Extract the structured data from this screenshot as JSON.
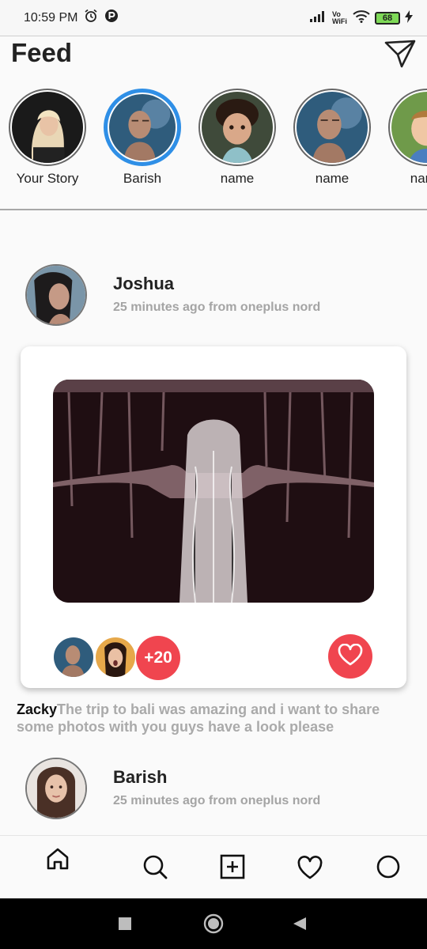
{
  "status_bar": {
    "time": "10:59 PM",
    "network_label": "Vo WiFi",
    "battery": "68"
  },
  "header": {
    "title": "Feed",
    "icons": {
      "send": "paper-plane-icon"
    }
  },
  "stories": [
    {
      "label": "Your Story",
      "active": false
    },
    {
      "label": "Barish",
      "active": true
    },
    {
      "label": "name",
      "active": false
    },
    {
      "label": "name",
      "active": false
    },
    {
      "label": "name",
      "active": false
    }
  ],
  "posts": [
    {
      "author": "Joshua",
      "meta": "25 minutes ago from oneplus nord",
      "likers_more": "+20",
      "caption_author": "Zacky",
      "caption_text": "The trip to bali was amazing and i want to share some photos with you guys have a look please"
    },
    {
      "author": "Barish",
      "meta": "25 minutes ago from oneplus nord"
    }
  ],
  "bottom_nav": [
    "home-icon",
    "search-icon",
    "add-post-icon",
    "heart-icon",
    "profile-icon"
  ],
  "colors": {
    "accent": "#f0454f",
    "story_ring": "#2f8fe6",
    "muted_text": "#a4a4a4"
  }
}
